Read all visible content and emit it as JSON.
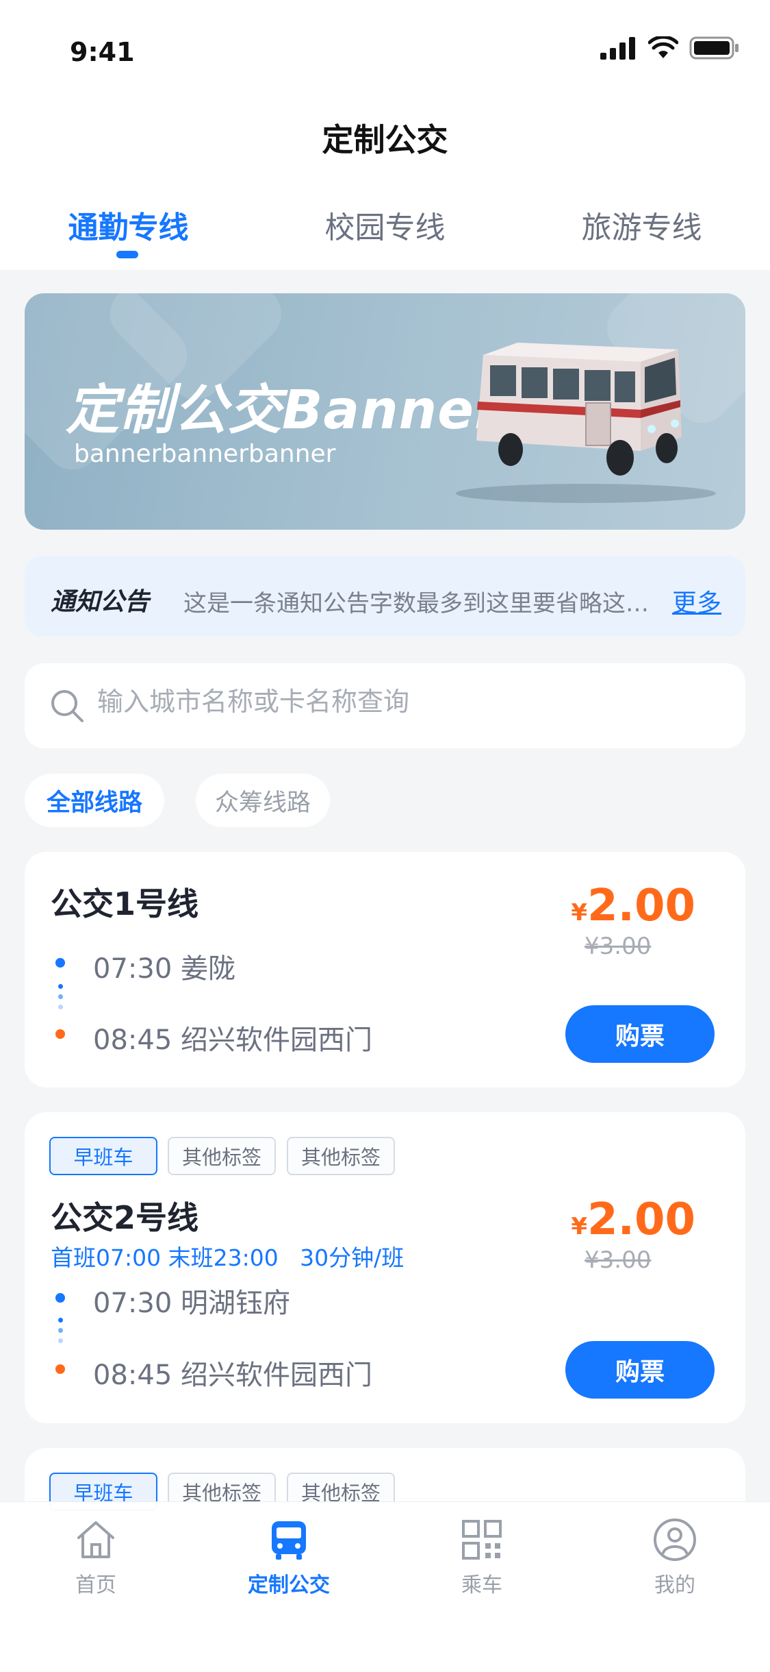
{
  "status_bar": {
    "time": "9:41"
  },
  "header": {
    "title": "定制公交",
    "tabs": [
      {
        "label": "通勤专线",
        "active": true
      },
      {
        "label": "校园专线",
        "active": false
      },
      {
        "label": "旅游专线",
        "active": false
      }
    ]
  },
  "banner": {
    "title": "定制公交Banner",
    "subtitle": "bannerbannerbanner"
  },
  "notice": {
    "label": "通知公告",
    "text": "这是一条通知公告字数最多到这里要省略这是一条通知公告",
    "more": "更多"
  },
  "search": {
    "placeholder": "输入城市名称或卡名称查询"
  },
  "filters": [
    {
      "label": "全部线路",
      "active": true
    },
    {
      "label": "众筹线路",
      "active": false
    }
  ],
  "routes": [
    {
      "name": "公交1号线",
      "tags": [],
      "schedule": "",
      "departure": {
        "time": "07:30",
        "stop": "姜陇"
      },
      "arrival": {
        "time": "08:45",
        "stop": "绍兴软件园西门"
      },
      "currency": "¥",
      "price": "2.00",
      "original_price": "¥3.00",
      "buy_label": "购票"
    },
    {
      "name": "公交2号线",
      "tags": [
        "早班车",
        "其他标签",
        "其他标签"
      ],
      "schedule": "首班07:00 末班23:00   30分钟/班",
      "departure": {
        "time": "07:30",
        "stop": "明湖钰府"
      },
      "arrival": {
        "time": "08:45",
        "stop": "绍兴软件园西门"
      },
      "currency": "¥",
      "price": "2.00",
      "original_price": "¥3.00",
      "buy_label": "购票"
    },
    {
      "name": "",
      "tags": [
        "早班车",
        "其他标签",
        "其他标签"
      ]
    }
  ],
  "tab_bar": [
    {
      "label": "首页",
      "icon": "home-icon",
      "active": false
    },
    {
      "label": "定制公交",
      "icon": "bus-icon",
      "active": true
    },
    {
      "label": "乘车",
      "icon": "qr-code-icon",
      "active": false
    },
    {
      "label": "我的",
      "icon": "profile-icon",
      "active": false
    }
  ],
  "colors": {
    "accent": "#1677ff",
    "price": "#ff6a1a",
    "background": "#f4f5f7"
  }
}
